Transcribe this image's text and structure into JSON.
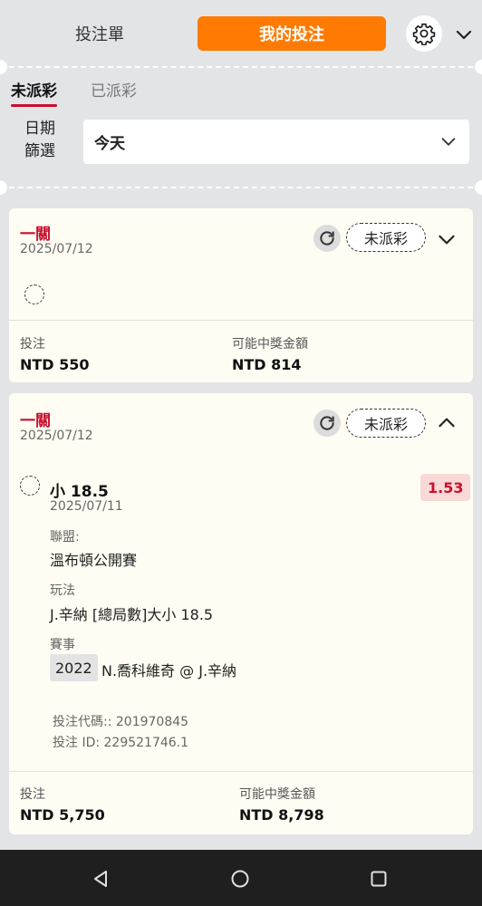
{
  "header": {
    "betslip_tab": "投注單",
    "mybets_tab": "我的投注",
    "accent": "#ff7a00"
  },
  "subtabs": {
    "unsettled": "未派彩",
    "settled": "已派彩"
  },
  "date_filter": {
    "label": "日期\n篩選",
    "label_line1": "日期",
    "label_line2": "篩選",
    "value": "今天"
  },
  "cards": [
    {
      "bet_type": "一關",
      "date": "2025/07/12",
      "status": "未派彩",
      "stake_label": "投注",
      "stake_value": "NTD 550",
      "payout_label": "可能中獎金額",
      "payout_value": "NTD 814"
    },
    {
      "bet_type": "一關",
      "date": "2025/07/12",
      "status": "未派彩",
      "selection": {
        "name": "小 18.5",
        "date": "2025/07/11",
        "odds": "1.53",
        "league_label": "聯盟:",
        "league_value": "溫布頓公開賽",
        "market_label": "玩法",
        "market_value": "J.辛納 [總局數]大小 18.5",
        "event_label": "賽事",
        "event_year": "2022",
        "event_value": "N.喬科維奇 @ J.辛納"
      },
      "bet_code": "投注代碼:: 201970845",
      "bet_id": "投注 ID: 229521746.1",
      "stake_label": "投注",
      "stake_value": "NTD 5,750",
      "payout_label": "可能中獎金額",
      "payout_value": "NTD 8,798"
    }
  ],
  "navbar": {
    "icons": [
      "back-icon",
      "home-icon",
      "recents-icon"
    ]
  }
}
